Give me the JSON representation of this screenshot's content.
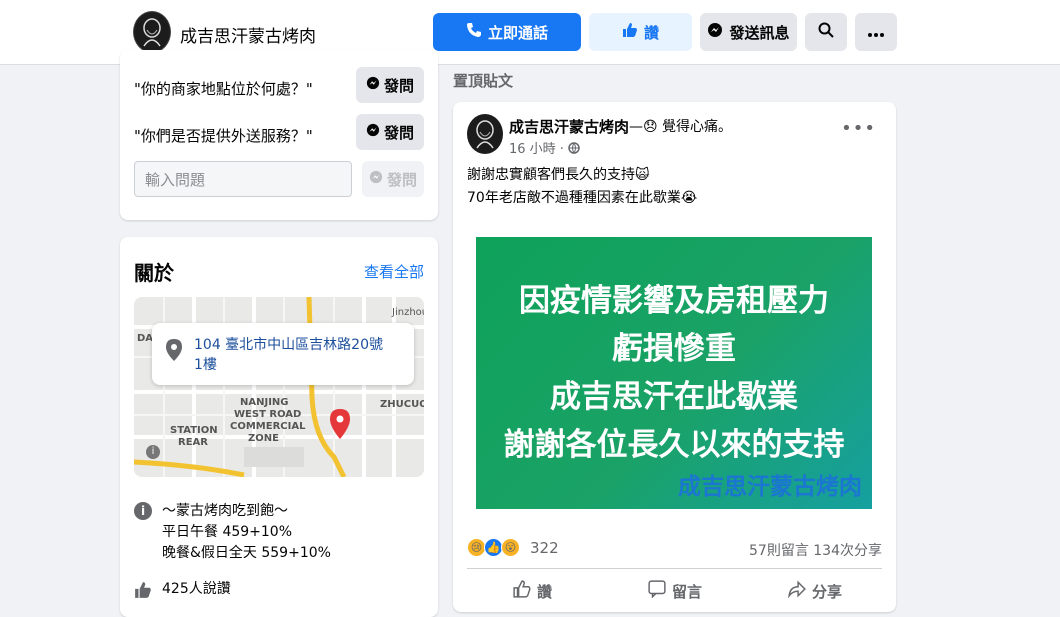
{
  "header": {
    "page_name": "成吉思汗蒙古烤肉",
    "call_label": "立即通話",
    "like_label": "讚",
    "message_label": "發送訊息",
    "colors": {
      "primary": "#1877f2",
      "secondary_bg": "#e4e6eb",
      "like_bg": "#e7f3ff"
    }
  },
  "questions": {
    "items": [
      {
        "text": "\"你的商家地點位於何處？\"",
        "button": "發問"
      },
      {
        "text": "\"你們是否提供外送服務？\"",
        "button": "發問"
      }
    ],
    "input_placeholder": "輸入問題",
    "input_button": "發問"
  },
  "about": {
    "title": "關於",
    "see_all": "查看全部",
    "address_line1": "104 臺北市中山區吉林路20號",
    "address_line2": "1樓",
    "map_labels": {
      "nanjing": "NANJING",
      "west_road": "WEST ROAD",
      "commercial": "COMMERCIAL",
      "zone": "ZONE",
      "station": "STATION",
      "rear": "REAR",
      "zhucuo": "ZHUCUO",
      "dac": "DAC",
      "jinzhou": "Jinzhou"
    },
    "info_line1": "～蒙古烤肉吃到飽～",
    "info_line2": "平日午餐 459+10%",
    "info_line3": "晚餐&假日全天 559+10%",
    "likes_text": "425人說讚"
  },
  "feed": {
    "pinned_label": "置頂貼文",
    "post": {
      "author": "成吉思汗蒙古烤肉",
      "feeling": "—😞 覺得心痛。",
      "time": "16 小時 ·",
      "text_line1": "謝謝忠實顧客們長久的支持🙀",
      "text_line2": "70年老店敵不過種種因素在此歇業😭",
      "image_lines": [
        "因疫情影響及房租壓力",
        "虧損慘重",
        "成吉思汗在此歇業",
        "謝謝各位長久以來的支持"
      ],
      "image_signature": "成吉思汗蒙古烤肉",
      "reaction_count": "322",
      "comments_shares": "57則留言  134次分享",
      "action_like": "讚",
      "action_comment": "留言",
      "action_share": "分享"
    }
  }
}
